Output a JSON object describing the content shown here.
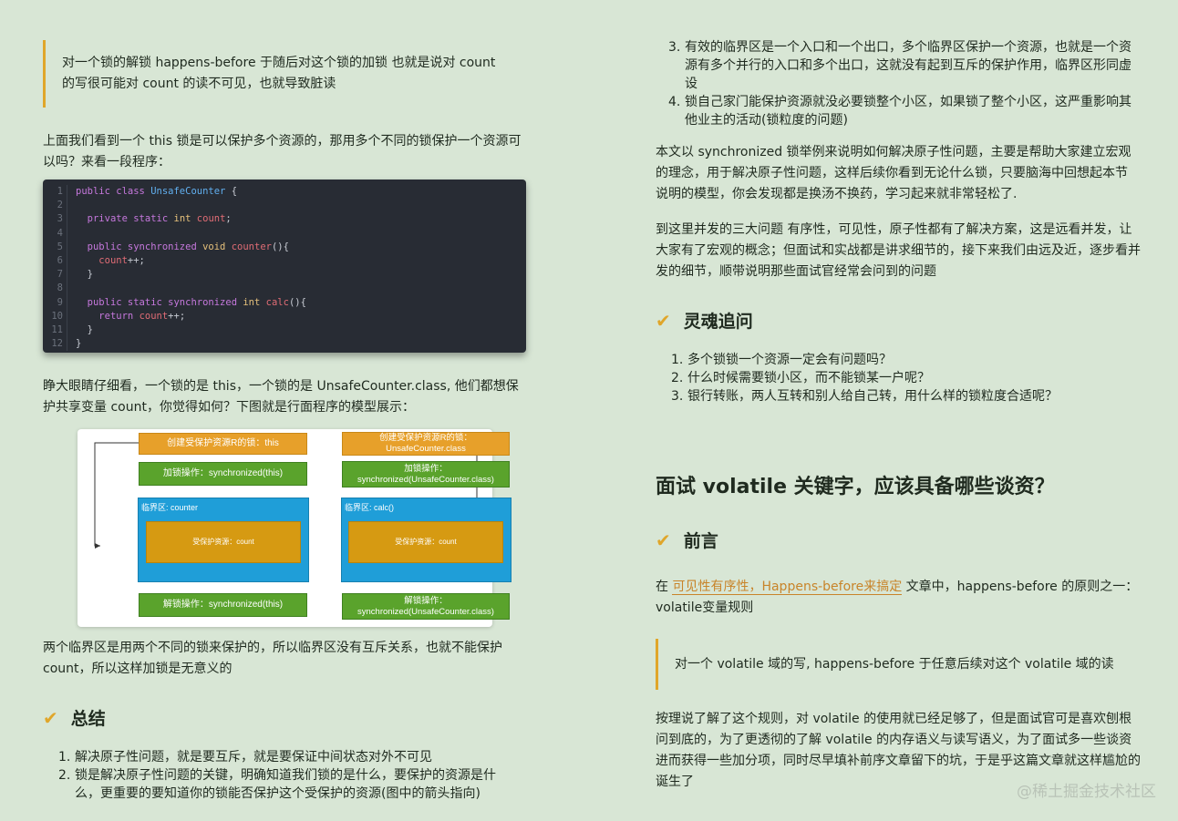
{
  "left": {
    "quote1": "对一个锁的解锁 happens-before 于随后对这个锁的加锁 也就是说对 count 的写很可能对 count 的读不可见，也就导致脏读",
    "para1": "上面我们看到一个 this 锁是可以保护多个资源的，那用多个不同的锁保护一个资源可以吗？来看一段程序：",
    "code_line_numbers": [
      "1",
      "2",
      "3",
      "4",
      "5",
      "6",
      "7",
      "8",
      "9",
      "10",
      "11",
      "12"
    ],
    "para2": "睁大眼睛仔细看，一个锁的是 this，一个锁的是 UnsafeCounter.class, 他们都想保护共享变量 count，你觉得如何？下图就是行面程序的模型展示：",
    "diagram": {
      "left_lock": "创建受保护资源R的锁：this",
      "left_acquire": "加锁操作：synchronized(this)",
      "left_critical": "临界区: counter",
      "left_resource": "受保护资源：count",
      "left_release": "解锁操作：synchronized(this)",
      "right_lock": "创建受保护资源R的锁：UnsafeCounter.class",
      "right_acquire": "加锁操作：synchronized(UnsafeCounter.class)",
      "right_critical": "临界区: calc()",
      "right_resource": "受保护资源：count",
      "right_release": "解锁操作：synchronized(UnsafeCounter.class)"
    },
    "para3": "两个临界区是用两个不同的锁来保护的，所以临界区没有互斥关系，也就不能保护 count，所以这样加锁是无意义的",
    "summary_title": "总结",
    "summary_items": [
      {
        "n": "1.",
        "text": "解决原子性问题，就是要互斥，就是要保证中间状态对外不可见"
      },
      {
        "n": "2.",
        "text": "锁是解决原子性问题的关键，明确知道我们锁的是什么，要保护的资源是什么，更重要的要知道你的锁能否保护这个受保护的资源(图中的箭头指向)"
      }
    ]
  },
  "right": {
    "items_top": [
      {
        "n": "3.",
        "text": "有效的临界区是一个入口和一个出口，多个临界区保护一个资源，也就是一个资源有多个并行的入口和多个出口，这就没有起到互斥的保护作用，临界区形同虚设"
      },
      {
        "n": "4.",
        "text": "锁自己家门能保护资源就没必要锁整个小区，如果锁了整个小区，这严重影响其他业主的活动(锁粒度的问题)"
      }
    ],
    "para1": "本文以 synchronized 锁举例来说明如何解决原子性问题，主要是帮助大家建立宏观的理念，用于解决原子性问题，这样后续你看到无论什么锁，只要脑海中回想起本节说明的模型，你会发现都是换汤不换药，学习起来就非常轻松了.",
    "para2": "到这里并发的三大问题 有序性，可见性，原子性都有了解决方案，这是远看并发，让大家有了宏观的概念；但面试和实战都是讲求细节的，接下来我们由远及近，逐步看并发的细节，顺带说明那些面试官经常会问到的问题",
    "soul_title": "灵魂追问",
    "soul_items": [
      {
        "n": "1.",
        "text": "多个锁锁一个资源一定会有问题吗？"
      },
      {
        "n": "2.",
        "text": "什么时候需要锁小区，而不能锁某一户呢？"
      },
      {
        "n": "3.",
        "text": "银行转账，两人互转和别人给自己转，用什么样的锁粒度合适呢？"
      }
    ],
    "big_title": "面试 volatile 关键字，应该具备哪些谈资？",
    "preface_title": "前言",
    "preface_pre": "在 ",
    "preface_link": "可见性有序性，Happens-before来搞定",
    "preface_post": " 文章中，happens-before 的原则之一：volatile变量规则",
    "quote2": "对一个 volatile 域的写, happens-before 于任意后续对这个 volatile 域的读",
    "para3": "按理说了解了这个规则，对 volatile 的使用就已经足够了，但是面试官可是喜欢刨根问到底的，为了更透彻的了解 volatile 的内存语义与读写语义，为了面试多一些谈资进而获得一些加分项，同时尽早填补前序文章留下的坑，于是乎这篇文章就这样尴尬的诞生了"
  },
  "watermark": "@稀土掘金技术社区"
}
